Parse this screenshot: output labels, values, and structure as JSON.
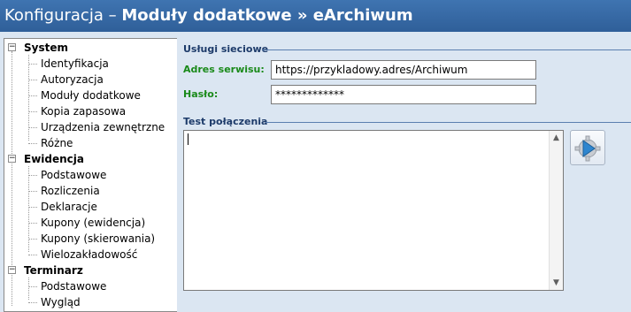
{
  "title": {
    "prefix": "Konfiguracja – ",
    "bold": "Moduły dodatkowe » eArchiwum"
  },
  "tree": [
    {
      "label": "System",
      "children": [
        "Identyfikacja",
        "Autoryzacja",
        "Moduły dodatkowe",
        "Kopia zapasowa",
        "Urządzenia zewnętrzne",
        "Różne"
      ]
    },
    {
      "label": "Ewidencja",
      "children": [
        "Podstawowe",
        "Rozliczenia",
        "Deklaracje",
        "Kupony (ewidencja)",
        "Kupony (skierowania)",
        "Wielozakładowość"
      ]
    },
    {
      "label": "Terminarz",
      "children": [
        "Podstawowe",
        "Wygląd"
      ]
    }
  ],
  "toggle_glyph": "−",
  "web_services": {
    "group_title": "Usługi sieciowe",
    "address_label": "Adres serwisu:",
    "address_value": "https://przykladowy.adres/Archiwum",
    "password_label": "Hasło:",
    "password_value": "*************"
  },
  "connection_test": {
    "group_title": "Test połączenia",
    "log": ""
  },
  "icons": {
    "scroll_up": "▲",
    "scroll_down": "▼"
  },
  "colors": {
    "title_bg": "#3564a2",
    "label_green": "#1a8a1a",
    "group_blue": "#1d3b6a",
    "panel_bg": "#dbe6f2"
  }
}
